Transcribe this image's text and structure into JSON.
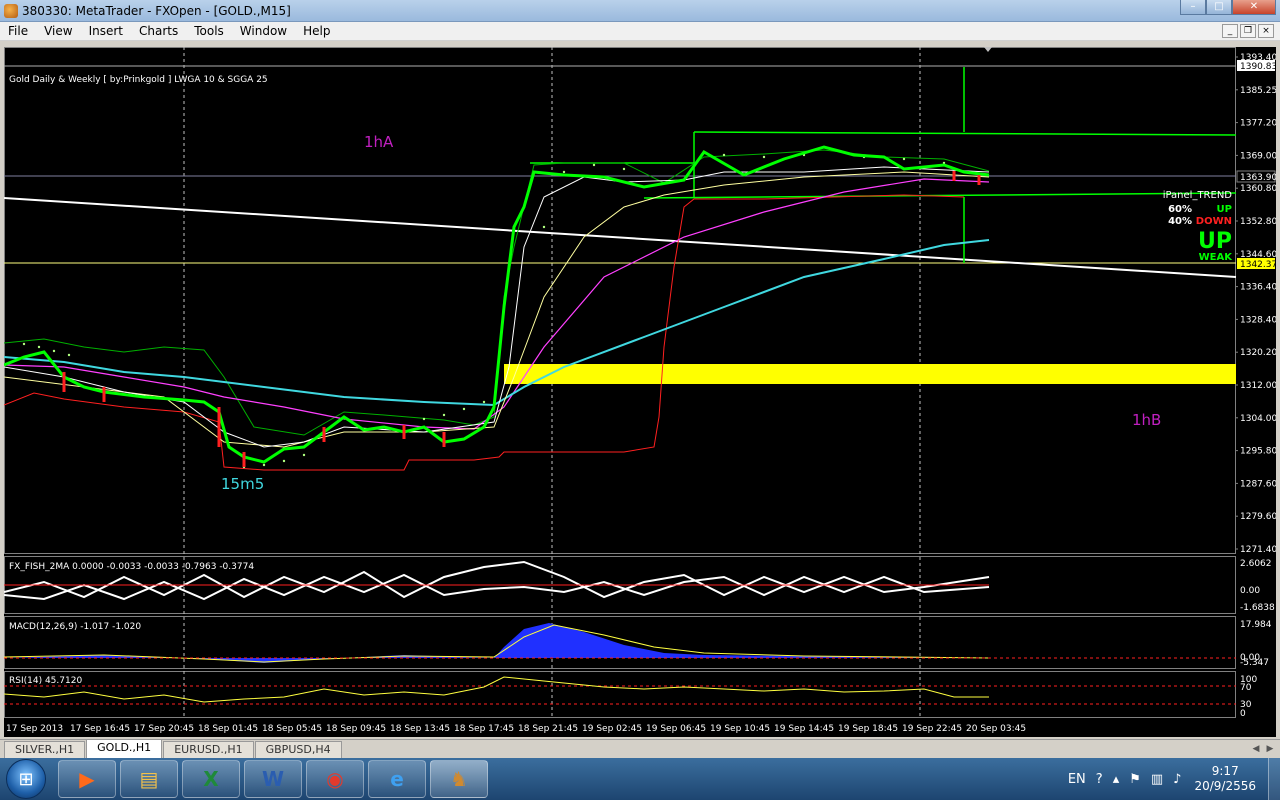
{
  "window": {
    "title": "380330: MetaTrader - FXOpen - [GOLD.,M15]",
    "controls": [
      "–",
      "□",
      "✕"
    ],
    "mdi_controls": [
      "_",
      "❐",
      "×"
    ]
  },
  "menu": [
    "File",
    "View",
    "Insert",
    "Charts",
    "Tools",
    "Window",
    "Help"
  ],
  "chart": {
    "header": "Gold Daily & Weekly [ by:Prinkgold ]  LWGA 10  &  SGGA 25",
    "annotations": {
      "a1": "1hA",
      "a2": "1hB",
      "a3": "15m5"
    },
    "ipanel": {
      "title": "iPanel_TREND",
      "up_pct": "60%",
      "up_label": "UP",
      "down_pct": "40%",
      "down_label": "DOWN",
      "trend": "UP",
      "strength": "WEAK"
    },
    "price_labels": [
      "1393.40",
      "1385.25",
      "1377.20",
      "1369.00",
      "1360.80",
      "1352.80",
      "1344.60",
      "1336.40",
      "1328.40",
      "1320.20",
      "1312.00",
      "1304.00",
      "1295.80",
      "1287.60",
      "1279.60",
      "1271.40"
    ],
    "price_highlights": {
      "top": "1390.83",
      "current": "1363.90",
      "line": "1342.37"
    },
    "time_labels": [
      "17 Sep 2013",
      "17 Sep 16:45",
      "17 Sep 20:45",
      "18 Sep 01:45",
      "18 Sep 05:45",
      "18 Sep 09:45",
      "18 Sep 13:45",
      "18 Sep 17:45",
      "18 Sep 21:45",
      "19 Sep 02:45",
      "19 Sep 06:45",
      "19 Sep 10:45",
      "19 Sep 14:45",
      "19 Sep 18:45",
      "19 Sep 22:45",
      "20 Sep 03:45"
    ]
  },
  "fisher": {
    "label": "FX_FISH_2MA 0.0000 -0.0033 -0.0033 -0.7963 -0.3774",
    "levels": [
      "2.6062",
      "0.00",
      "-1.6838"
    ]
  },
  "macd": {
    "label": "MACD(12,26,9) -1.017 -1.020",
    "levels": [
      "17.984",
      "0.00",
      "-5.347"
    ]
  },
  "rsi": {
    "label": "RSI(14) 45.7120",
    "levels": [
      "100",
      "70",
      "30",
      "0"
    ]
  },
  "tabs": [
    "SILVER.,H1",
    "GOLD.,H1",
    "EURUSD.,H1",
    "GBPUSD,H4"
  ],
  "active_tab": 1,
  "taskbar": {
    "apps": [
      "presentation",
      "explorer",
      "excel",
      "word",
      "chrome",
      "internet-explorer",
      "metatrader"
    ],
    "tray": {
      "lang": "EN",
      "time": "9:17",
      "date": "20/9/2556"
    }
  },
  "colors": {
    "bull": "#00ff00",
    "bear": "#ff2020",
    "yellow_zone": "#ffff00",
    "magenta": "#ff00ff",
    "cyan": "#40d8e0"
  }
}
